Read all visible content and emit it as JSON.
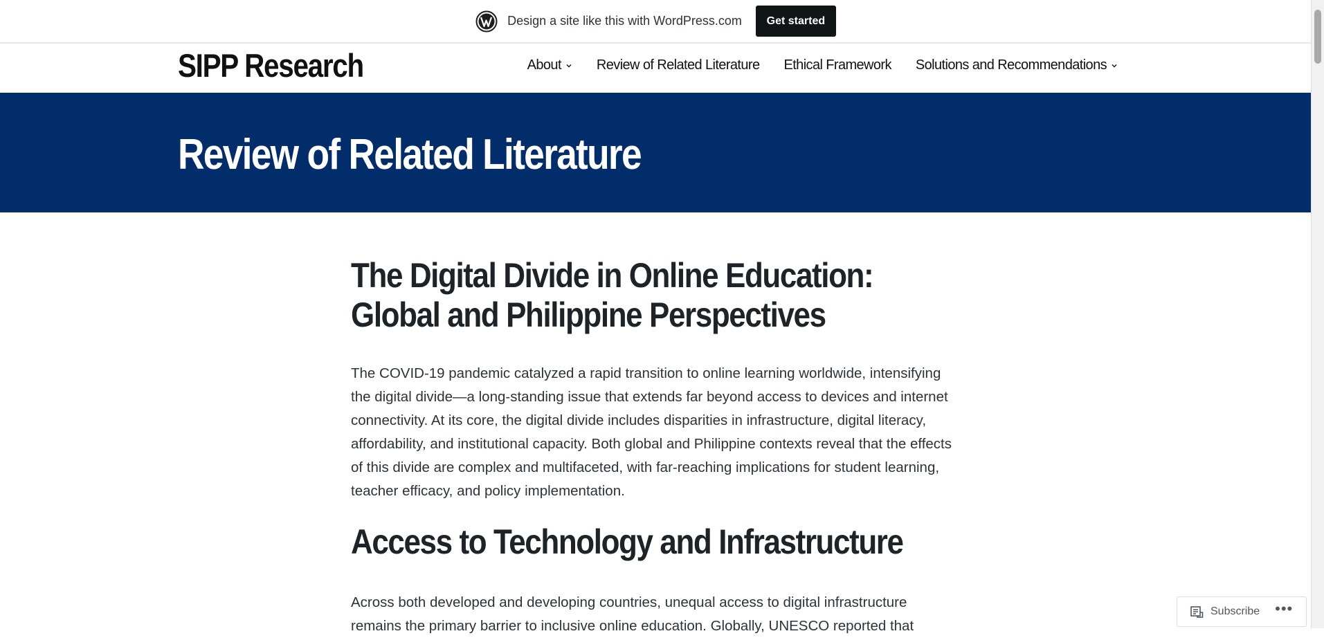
{
  "wp_bar": {
    "logo_icon": "wordpress-logo-icon",
    "text": "Design a site like this with WordPress.com",
    "cta_label": "Get started"
  },
  "header": {
    "site_title": "SIPP Research",
    "nav": [
      {
        "label": "About",
        "has_dropdown": true
      },
      {
        "label": "Review of Related Literature",
        "has_dropdown": false
      },
      {
        "label": "Ethical Framework",
        "has_dropdown": false
      },
      {
        "label": "Solutions and Recommendations",
        "has_dropdown": true
      }
    ]
  },
  "hero": {
    "title": "Review of Related Literature",
    "background": "#012d6b"
  },
  "article": {
    "heading1": "The Digital Divide in Online Education: Global and Philippine Perspectives",
    "paragraph1": "The COVID-19 pandemic catalyzed a rapid transition to online learning worldwide, intensifying the digital divide—a long-standing issue that extends far beyond access to devices and internet connectivity. At its core, the digital divide includes disparities in infrastructure, digital literacy, affordability, and institutional capacity. Both global and Philippine contexts reveal that the effects of this divide are complex and multifaceted, with far-reaching implications for student learning, teacher efficacy, and policy implementation.",
    "heading2": "Access to Technology and Infrastructure",
    "paragraph2": "Across both developed and developing countries, unequal access to digital infrastructure remains the primary barrier to inclusive online education. Globally, UNESCO reported that"
  },
  "subscribe_widget": {
    "icon": "reader-icon",
    "label": "Subscribe",
    "more": "•••"
  }
}
